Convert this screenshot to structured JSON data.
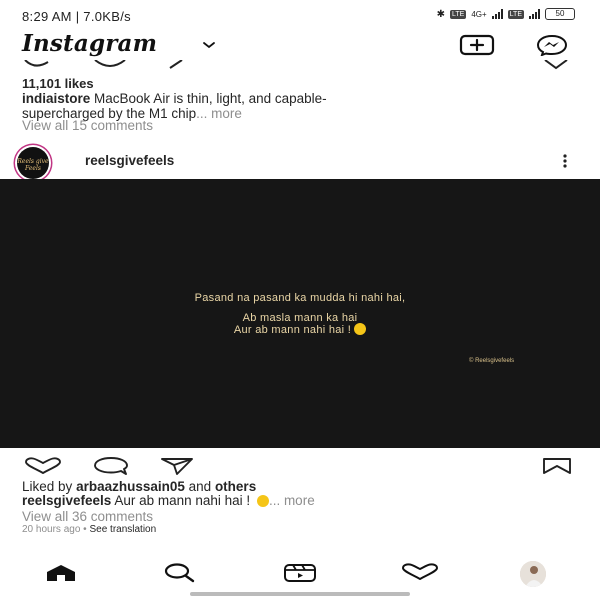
{
  "status_bar": {
    "time": "8:29 AM | 7.0KB/s",
    "net_label": "4G+",
    "lte1": "LTE",
    "lte2": "LTE",
    "battery": "50"
  },
  "header": {
    "logo": "Instagram",
    "icons": [
      "chevron-down-icon",
      "add-post-icon",
      "messenger-icon"
    ]
  },
  "prev_post": {
    "likes": "11,101 likes",
    "username": "indiaistore",
    "caption_line1": "MacBook Air is thin, light, and capable-",
    "caption_line2": "supercharged by the M1 chip",
    "more": "... more",
    "view_comments": "View all 15 comments"
  },
  "post": {
    "username": "reelsgivefeels",
    "avatar_text": "Reels give Feels",
    "image_text": {
      "line1": "Pasand na pasand ka mudda hi nahi hai,",
      "line2": "Ab masla mann ka hai",
      "line3": "Aur ab mann nahi hai !",
      "watermark": "© Reelsgivefeels"
    },
    "liked_by_prefix": "Liked by",
    "liked_by_user": "arbaazhussain05",
    "liked_by_and": "and",
    "liked_by_others": "others",
    "caption_user": "reelsgivefeels",
    "caption_text": "Aur ab mann nahi hai !",
    "caption_more": "... more",
    "view_comments": "View all 36 comments",
    "time_ago": "20 hours ago",
    "dot": "•",
    "see_translation": "See translation"
  },
  "bottom_nav": {
    "items": [
      "home-icon",
      "search-icon",
      "reels-icon",
      "heart-icon",
      "profile-avatar"
    ]
  },
  "colors": {
    "post_bg": "#161616",
    "image_text": "#ead6a6",
    "muted": "#8e8e8e",
    "story_ring": "#c13584"
  }
}
